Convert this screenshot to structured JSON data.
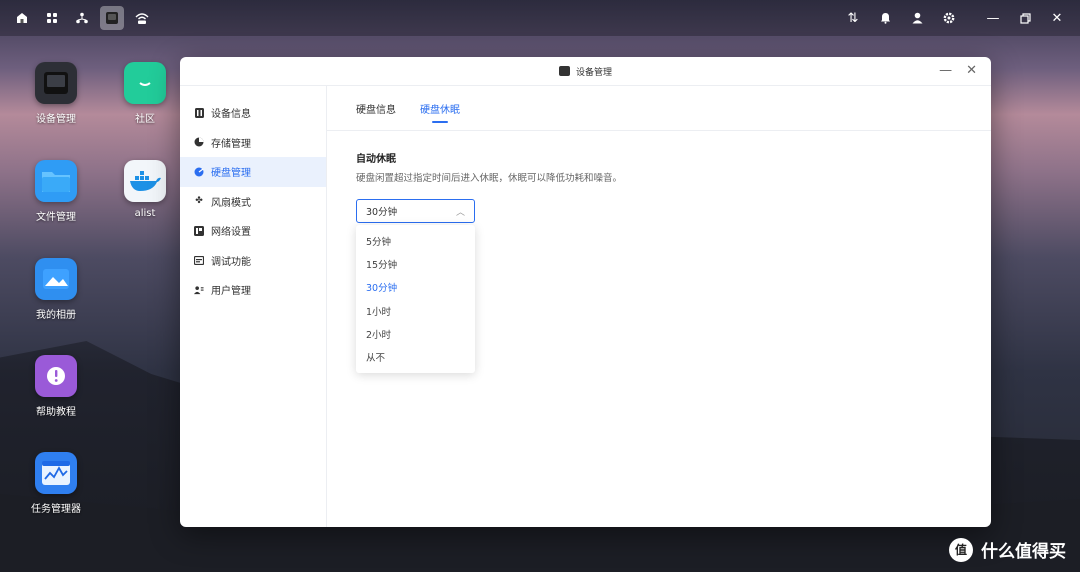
{
  "colors": {
    "accent": "#2b6ef0",
    "active_bg": "#eaf1fd"
  },
  "taskbar": {
    "left_icons": [
      "home-icon",
      "apps-grid-icon",
      "network-topology-icon",
      "device-manager-icon",
      "wifi-router-icon"
    ],
    "right_icons": [
      "transfer-icon",
      "bell-icon",
      "user-icon",
      "settings-icon",
      "minimize-icon",
      "restore-icon",
      "close-icon"
    ]
  },
  "desktop": {
    "icons": [
      {
        "label": "设备管理",
        "icon": "device-manager-icon"
      },
      {
        "label": "社区",
        "icon": "community-icon"
      },
      {
        "label": "文件管理",
        "icon": "folder-icon"
      },
      {
        "label": "alist",
        "icon": "docker-icon"
      },
      {
        "label": "我的相册",
        "icon": "photo-album-icon"
      },
      {
        "label": "帮助教程",
        "icon": "help-icon"
      },
      {
        "label": "任务管理器",
        "icon": "task-manager-icon"
      }
    ]
  },
  "window": {
    "title": "设备管理",
    "sidebar": [
      {
        "label": "设备信息",
        "icon": "info-icon"
      },
      {
        "label": "存储管理",
        "icon": "pie-chart-icon"
      },
      {
        "label": "硬盘管理",
        "icon": "disk-icon"
      },
      {
        "label": "风扇模式",
        "icon": "fan-icon"
      },
      {
        "label": "网络设置",
        "icon": "network-icon"
      },
      {
        "label": "调试功能",
        "icon": "debug-icon"
      },
      {
        "label": "用户管理",
        "icon": "users-icon"
      }
    ],
    "tabs": [
      "硬盘信息",
      "硬盘休眠"
    ],
    "section": {
      "title": "自动休眠",
      "desc": "硬盘闲置超过指定时间后进入休眠，休眠可以降低功耗和噪音。",
      "selected": "30分钟",
      "options": [
        "5分钟",
        "15分钟",
        "30分钟",
        "1小时",
        "2小时",
        "从不"
      ]
    }
  },
  "watermark": {
    "text": "什么值得买",
    "logo": "值"
  }
}
